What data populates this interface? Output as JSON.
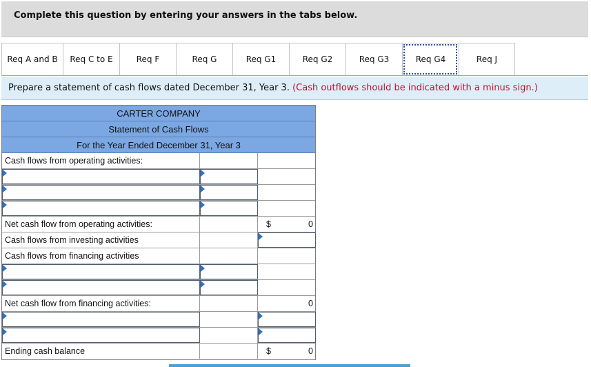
{
  "header": {
    "instruction": "Complete this question by entering your answers in the tabs below."
  },
  "tabs": [
    {
      "label": "Req A and B",
      "active": false
    },
    {
      "label": "Req C to E",
      "active": false
    },
    {
      "label": "Req F",
      "active": false
    },
    {
      "label": "Req G",
      "active": false
    },
    {
      "label": "Req G1",
      "active": false
    },
    {
      "label": "Req G2",
      "active": false
    },
    {
      "label": "Req G3",
      "active": false
    },
    {
      "label": "Req G4",
      "active": true
    },
    {
      "label": "Req J",
      "active": false
    }
  ],
  "prompt": {
    "text": "Prepare a statement of cash flows dated December 31, Year 3.",
    "note": "(Cash outflows should be indicated with a minus sign.)"
  },
  "statement": {
    "company": "CARTER COMPANY",
    "title": "Statement of Cash Flows",
    "period": "For the Year Ended December 31, Year 3",
    "operating_header": "Cash flows from operating activities:",
    "net_operating_label": "Net cash flow from operating activities:",
    "net_operating_currency": "$",
    "net_operating_value": "0",
    "investing_header": "Cash flows from investing activities",
    "financing_header": "Cash flows from financing activities",
    "net_financing_label": "Net cash flow from financing activities:",
    "net_financing_value": "0",
    "ending_label": "Ending cash balance",
    "ending_currency": "$",
    "ending_value": "0"
  },
  "colors": {
    "header_bg": "#7ba7e2",
    "tab_bar_bg": "#dcdcdc",
    "instruction_bg": "#ddeef9",
    "note_red": "#c0102c"
  }
}
